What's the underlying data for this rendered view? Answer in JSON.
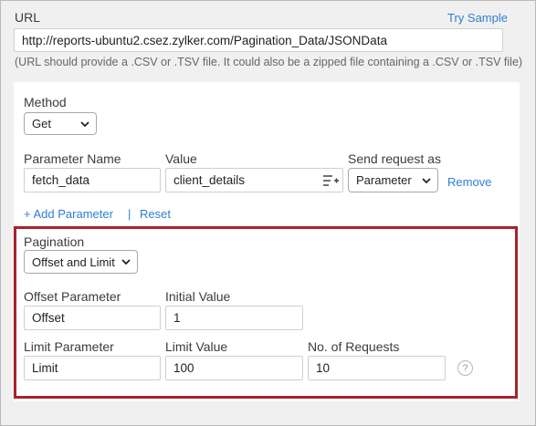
{
  "url": {
    "label": "URL",
    "try_sample": "Try Sample",
    "value": "http://reports-ubuntu2.csez.zylker.com/Pagination_Data/JSONData",
    "hint": "(URL should provide a .CSV or .TSV file. It could also be a zipped file containing a .CSV or .TSV file)"
  },
  "method": {
    "label": "Method",
    "selected": "Get"
  },
  "params": {
    "name_label": "Parameter Name",
    "value_label": "Value",
    "send_label": "Send request as",
    "name_value": "fetch_data",
    "value_value": "client_details",
    "send_selected": "Parameter",
    "remove": "Remove",
    "add": "+ Add Parameter",
    "separator": "|",
    "reset": "Reset"
  },
  "pagination": {
    "label": "Pagination",
    "selected": "Offset and Limit",
    "offset_param_label": "Offset Parameter",
    "offset_param_value": "Offset",
    "initial_value_label": "Initial Value",
    "initial_value": "1",
    "limit_param_label": "Limit Parameter",
    "limit_param_value": "Limit",
    "limit_value_label": "Limit Value",
    "limit_value": "100",
    "requests_label": "No. of Requests",
    "requests_value": "10",
    "help": "?"
  },
  "colors": {
    "link": "#2f7fd1",
    "highlight_border": "#a8232c"
  },
  "icons": {
    "value_picker": "list-add-icon",
    "select": "chevron-down-icon",
    "help": "help-circle-icon"
  }
}
